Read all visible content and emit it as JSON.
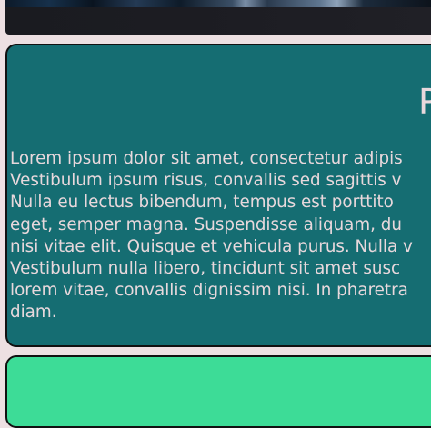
{
  "cards": [
    {
      "heading": "P",
      "body_lines": [
        "Lorem ipsum dolor sit amet, consectetur adipis",
        "Vestibulum ipsum risus, convallis sed sagittis v",
        "Nulla eu lectus bibendum, tempus est porttito",
        "eget, semper magna. Suspendisse aliquam, du",
        "nisi vitae elit. Quisque et vehicula purus. Nulla v",
        "Vestibulum nulla libero, tincidunt sit amet susc",
        "lorem vitae, convallis dignissim nisi. In pharetra",
        "diam."
      ]
    }
  ],
  "colors": {
    "page_background": "#ede0e2",
    "card_teal": "#156d72",
    "card_green": "#3ddc97",
    "text": "#e8d8dc"
  }
}
